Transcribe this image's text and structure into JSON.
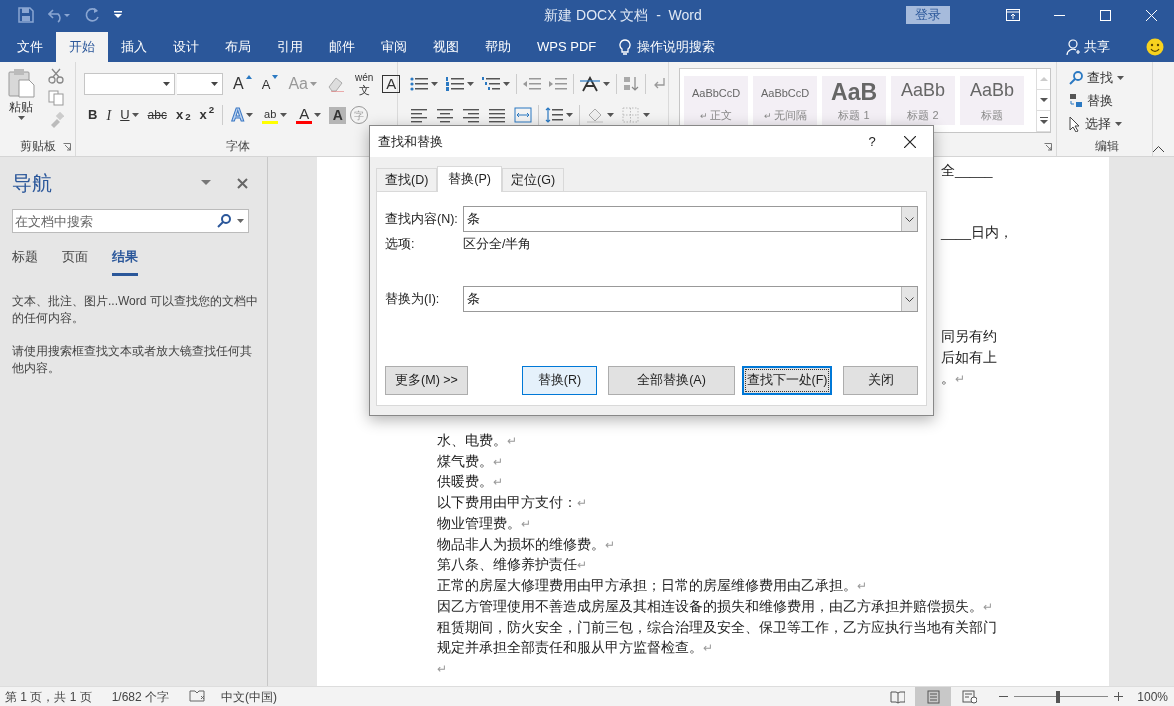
{
  "title_bar": {
    "title": "新建 DOCX 文档  -  Word",
    "sign_in": "登录"
  },
  "ribbon_tabs": [
    {
      "label": "文件",
      "selected": false
    },
    {
      "label": "开始",
      "selected": true
    },
    {
      "label": "插入",
      "selected": false
    },
    {
      "label": "设计",
      "selected": false
    },
    {
      "label": "布局",
      "selected": false
    },
    {
      "label": "引用",
      "selected": false
    },
    {
      "label": "邮件",
      "selected": false
    },
    {
      "label": "审阅",
      "selected": false
    },
    {
      "label": "视图",
      "selected": false
    },
    {
      "label": "帮助",
      "selected": false
    },
    {
      "label": "WPS PDF",
      "selected": false
    }
  ],
  "tell_me": "操作说明搜索",
  "share": "共享",
  "clipboard": {
    "paste": "粘贴",
    "label": "剪贴板"
  },
  "font": {
    "label": "字体",
    "row1": [
      {
        "kind": "grow",
        "glyph": "A"
      },
      {
        "kind": "shrink",
        "glyph": "A"
      },
      {
        "kind": "case",
        "glyph": "Aa"
      },
      {
        "kind": "clear"
      },
      {
        "kind": "phonetic",
        "glyph": "wén",
        "base": "文"
      },
      {
        "kind": "border",
        "glyph": "A"
      }
    ],
    "row2": [
      {
        "kind": "bold",
        "glyph": "B"
      },
      {
        "kind": "italic",
        "glyph": "I"
      },
      {
        "kind": "underline",
        "glyph": "U"
      },
      {
        "kind": "strike",
        "glyph": "abc"
      },
      {
        "kind": "script",
        "glyph": "x$_{2}$"
      },
      {
        "kind": "script",
        "glyph": "x$^{2}$"
      },
      {
        "kind": "effects",
        "glyph": "A"
      },
      {
        "kind": "highlight",
        "glyph": "ab",
        "color": "#ffff00"
      },
      {
        "kind": "fontcolor",
        "glyph": "A",
        "color": "#ff0000"
      },
      {
        "kind": "shading",
        "glyph": "A"
      },
      {
        "kind": "encircle",
        "glyph": "字"
      }
    ]
  },
  "styles": [
    {
      "preview": "AaBbCcD",
      "name": "正文",
      "mark": "↵",
      "kind": "normal"
    },
    {
      "preview": "AaBbCcD",
      "name": "无间隔",
      "mark": "↵",
      "kind": "normal"
    },
    {
      "preview": "AaB",
      "name": "标题 1",
      "kind": "heading1"
    },
    {
      "preview": "AaBb",
      "name": "标题 2",
      "kind": "heading2"
    },
    {
      "preview": "AaBb",
      "name": "标题",
      "kind": "title"
    }
  ],
  "editing": {
    "label": "编辑",
    "items": [
      {
        "kind": "find",
        "label": "查找"
      },
      {
        "kind": "replace",
        "label": "替换"
      },
      {
        "kind": "select",
        "label": "选择"
      }
    ]
  },
  "nav": {
    "title": "导航",
    "search_placeholder": "在文档中搜索",
    "tabs": [
      {
        "label": "标题",
        "selected": false
      },
      {
        "label": "页面",
        "selected": false
      },
      {
        "label": "结果",
        "selected": true
      }
    ],
    "messages": [
      "文本、批注、图片...Word 可以查找您的文档中的任何内容。",
      "请使用搜索框查找文本或者放大镜查找任何其他内容。"
    ]
  },
  "dialog": {
    "title": "查找和替换",
    "help": "?",
    "tabs": [
      {
        "label": "查找(D)",
        "selected": false
      },
      {
        "label": "替换(P)",
        "selected": true
      },
      {
        "label": "定位(G)",
        "selected": false
      }
    ],
    "find_label": "查找内容(N):",
    "find_value": "条",
    "options_label": "选项:",
    "options_value": "区分全/半角",
    "replace_label": "替换为(I):",
    "replace_value": "条",
    "buttons": [
      {
        "label": "更多(M) >>",
        "kind": "more"
      },
      {
        "label": "替换(R)",
        "kind": "hover"
      },
      {
        "label": "全部替换(A)",
        "kind": "normal"
      },
      {
        "label": "查找下一处(F)",
        "kind": "default"
      },
      {
        "label": "关闭",
        "kind": "normal"
      }
    ]
  },
  "document": [
    {
      "kind": "fragment",
      "text": "全_____"
    },
    {
      "kind": "blank"
    },
    {
      "kind": "blank"
    },
    {
      "kind": "fragment",
      "text": "____日内，"
    },
    {
      "kind": "blank"
    },
    {
      "kind": "blank"
    },
    {
      "kind": "blank"
    },
    {
      "kind": "blank"
    },
    {
      "kind": "fragment",
      "text": "同另有约"
    },
    {
      "kind": "fragment",
      "text": "后如有上"
    },
    {
      "kind": "fragment",
      "text": "。",
      "mark": "↵"
    },
    {
      "kind": "blank"
    },
    {
      "kind": "blank"
    },
    {
      "kind": "line",
      "text": "水、电费。",
      "mark": "↵"
    },
    {
      "kind": "line",
      "text": "煤气费。",
      "mark": "↵"
    },
    {
      "kind": "line",
      "text": "供暖费。",
      "mark": "↵"
    },
    {
      "kind": "line",
      "text": "以下费用由甲方支付：",
      "mark": "↵"
    },
    {
      "kind": "line",
      "text": "物业管理费。",
      "mark": "↵"
    },
    {
      "kind": "line",
      "text": "物品非人为损坏的维修费。",
      "mark": "↵"
    },
    {
      "kind": "line",
      "text": "第八条、维修养护责任",
      "mark": "↵"
    },
    {
      "kind": "line",
      "text": "正常的房屋大修理费用由甲方承担；日常的房屋维修费用由乙承担。",
      "mark": "↵"
    },
    {
      "kind": "line",
      "text": "因乙方管理使用不善造成房屋及其相连设备的损失和维修费用，由乙方承担并赔偿损失。",
      "mark": "↵"
    },
    {
      "kind": "line",
      "text": "租赁期间，防火安全，门前三包，综合治理及安全、保卫等工作，乙方应执行当地有关部门"
    },
    {
      "kind": "line",
      "text": "规定并承担全部责任和服从甲方监督检查。",
      "mark": "↵"
    },
    {
      "kind": "empty",
      "mark": "↵"
    }
  ],
  "status_bar": {
    "page": "第 1 页，共 1 页",
    "words": "1/682 个字",
    "language": "中文(中国)",
    "zoom": "100%",
    "zoom_slider": {
      "level": 0.46
    },
    "views": [
      {
        "kind": "read",
        "selected": false
      },
      {
        "kind": "print",
        "selected": true
      },
      {
        "kind": "web",
        "selected": false
      }
    ]
  }
}
